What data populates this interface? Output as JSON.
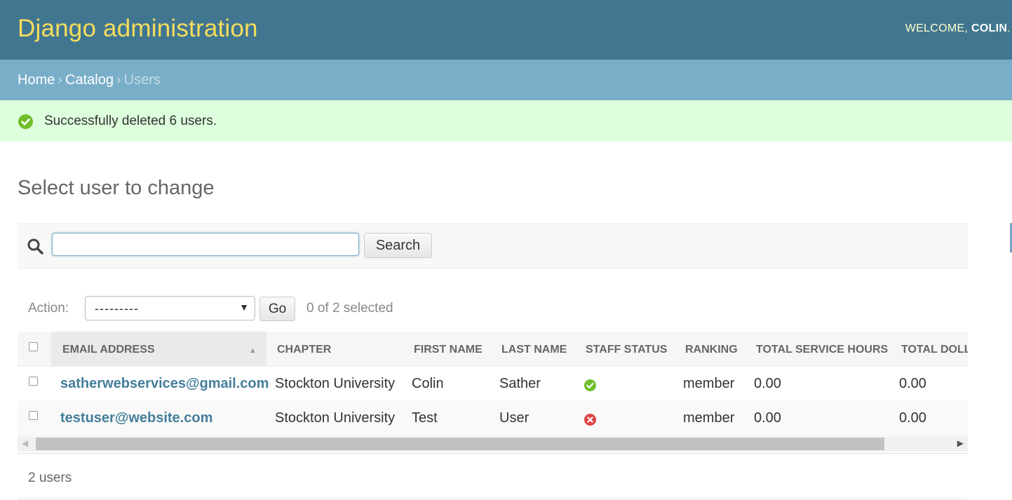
{
  "header": {
    "site_title": "Django administration",
    "welcome": "WELCOME,",
    "username": "COLIN",
    "trail": "."
  },
  "breadcrumbs": {
    "items": [
      "Home",
      "Catalog"
    ],
    "separator": "›",
    "current": "Users"
  },
  "messages": {
    "success": "Successfully deleted 6 users."
  },
  "page": {
    "title": "Select user to change"
  },
  "search": {
    "value": "",
    "placeholder": "",
    "button_label": "Search"
  },
  "actions": {
    "label": "Action:",
    "selected_option": "---------",
    "go_label": "Go",
    "counter": "0 of 2 selected"
  },
  "table": {
    "columns": [
      "EMAIL ADDRESS",
      "CHAPTER",
      "FIRST NAME",
      "LAST NAME",
      "STAFF STATUS",
      "RANKING",
      "TOTAL SERVICE HOURS",
      "TOTAL DOLL..."
    ],
    "sorted_column": "EMAIL ADDRESS",
    "rows": [
      {
        "email": "satherwebservices@gmail.com",
        "chapter": "Stockton University",
        "first_name": "Colin",
        "last_name": "Sather",
        "staff_status": true,
        "ranking": "member",
        "total_service_hours": "0.00",
        "total_dollars": "0.00"
      },
      {
        "email": "testuser@website.com",
        "chapter": "Stockton University",
        "first_name": "Test",
        "last_name": "User",
        "staff_status": false,
        "ranking": "member",
        "total_service_hours": "0.00",
        "total_dollars": "0.00"
      }
    ]
  },
  "paginator": {
    "count": "2 users"
  },
  "colors": {
    "header_bg": "#417690",
    "title_yellow": "#f5dd5d",
    "breadcrumb_bg": "#79aec8",
    "success_bg": "#ddffdd",
    "link_blue": "#447e9b",
    "yes_green": "#70bf2b",
    "no_red": "#dd4646"
  },
  "icons": {
    "success": "check-circle-icon",
    "search": "magnifier-icon",
    "staff_yes": "check-circle-icon",
    "staff_no": "x-circle-icon"
  }
}
